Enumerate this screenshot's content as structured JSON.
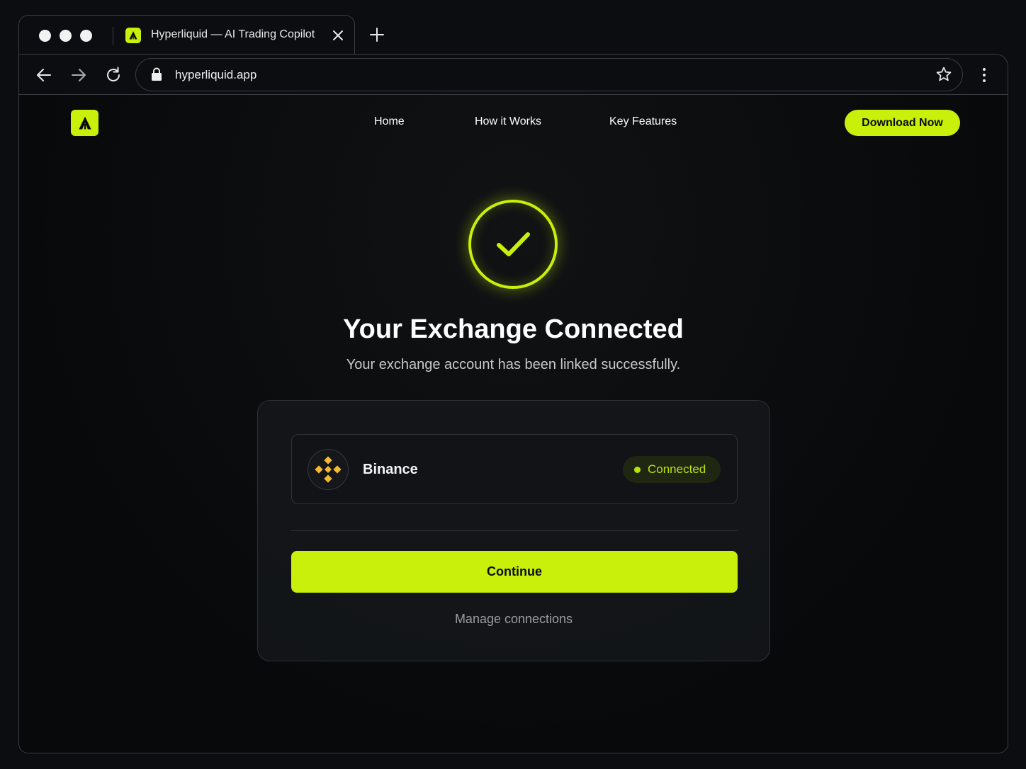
{
  "browser": {
    "tab_title": "Hyperliquid — AI Trading Copilot",
    "url": "hyperliquid.app"
  },
  "site": {
    "nav": [
      "Home",
      "How it Works",
      "Key Features"
    ],
    "cta": "Download Now",
    "accent": "#c8f00a"
  },
  "main": {
    "title": "Your Exchange Connected",
    "subtitle": "Your exchange account has been linked successfully.",
    "exchange": {
      "name": "Binance",
      "status": "Connected",
      "logo_color": "#f3ba2f"
    },
    "continue_label": "Continue",
    "manage_label": "Manage connections"
  },
  "icons": [
    "logo-icon",
    "close-icon",
    "plus-icon",
    "back-arrow-icon",
    "forward-arrow-icon",
    "reload-icon",
    "lock-icon",
    "star-icon",
    "more-vertical-icon",
    "checkmark-icon",
    "binance-icon"
  ]
}
